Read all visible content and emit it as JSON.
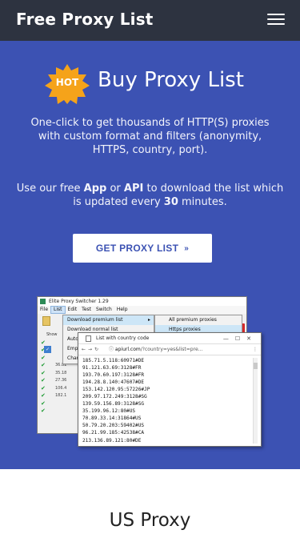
{
  "header": {
    "brand": "Free Proxy List",
    "menu_icon": "hamburger-icon"
  },
  "hero": {
    "badge": "HOT",
    "title": "Buy Proxy List",
    "description": "One-click to get thousands of HTTP(S) proxies with custom format and filters (anonymity, HTTPS, country, port).",
    "note": {
      "part1": "Use our free ",
      "app": "App",
      "part2": " or ",
      "api": "API",
      "part3": " to download the list which is updated every ",
      "minutes": "30",
      "part4": " minutes."
    },
    "cta_label": "GET PROXY LIST",
    "cta_icon": "chevron-double-down-icon",
    "colors": {
      "hero_bg": "#3c52b3",
      "topbar_bg": "#2d3340",
      "badge": "#f5a31a"
    }
  },
  "screenshot": {
    "app_title": "Elite Proxy Switcher 1.29",
    "menu": [
      "File",
      "List",
      "Edit",
      "Test",
      "Switch",
      "Help"
    ],
    "dropdown": [
      "Download premium list",
      "Download normal list",
      "Auto",
      "Empt",
      "Chan"
    ],
    "submenu": [
      "All premium proxies",
      "Https proxies"
    ],
    "left_label": "Show",
    "left_rows": [
      "36.81",
      "35.18",
      "27.36",
      "106.4",
      "182.1"
    ],
    "browser_title": "List with country code",
    "url_host": "apiurl.com",
    "url_rest": "/?country=yes&list=pre...",
    "proxies": [
      "185.71.5.118:60971#DE",
      "91.121.63.69:3128#FR",
      "193.70.60.197:3128#FR",
      "194.28.8.140:47607#DE",
      "153.142.120.95:57226#JP",
      "209.97.172.249:3128#SG",
      "139.59.156.89:3128#SG",
      "35.199.96.12:80#US",
      "70.89.33.14:31864#US",
      "50.79.20.203:59402#US",
      "96.21.99.185:42538#CA",
      "213.136.89.121:80#DE"
    ]
  },
  "next_section": {
    "title": "US Proxy"
  }
}
